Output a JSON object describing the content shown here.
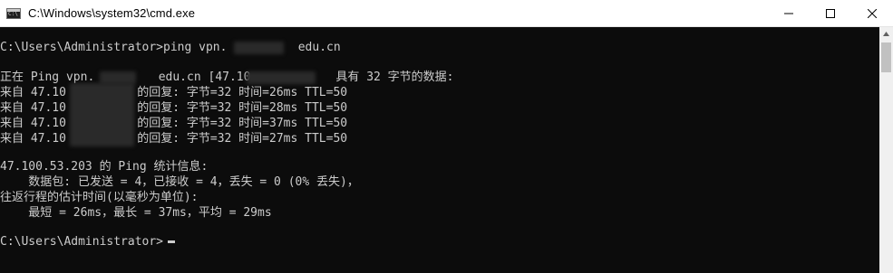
{
  "window": {
    "title": "C:\\Windows\\system32\\cmd.exe",
    "icon": "cmd-icon"
  },
  "controls": {
    "minimize": "minimize-icon",
    "maximize": "maximize-icon",
    "close": "close-icon"
  },
  "console": {
    "lines": [
      "C:\\Users\\Administrator>ping vpn.          edu.cn",
      "",
      "正在 Ping vpn.         edu.cn [47.10            具有 32 字节的数据:",
      "来自 47.10          的回复: 字节=32 时间=26ms TTL=50",
      "来自 47.10          的回复: 字节=32 时间=28ms TTL=50",
      "来自 47.10          的回复: 字节=32 时间=37ms TTL=50",
      "来自 47.10          的回复: 字节=32 时间=27ms TTL=50",
      "",
      "47.100.53.203 的 Ping 统计信息:",
      "    数据包: 已发送 = 4，已接收 = 4，丢失 = 0 (0% 丢失)，",
      "往返行程的估计时间(以毫秒为单位):",
      "    最短 = 26ms，最长 = 37ms，平均 = 29ms",
      "",
      "C:\\Users\\Administrator>"
    ]
  },
  "colors": {
    "console_bg": "#0c0c0c",
    "console_fg": "#cccccc",
    "titlebar_bg": "#ffffff"
  }
}
